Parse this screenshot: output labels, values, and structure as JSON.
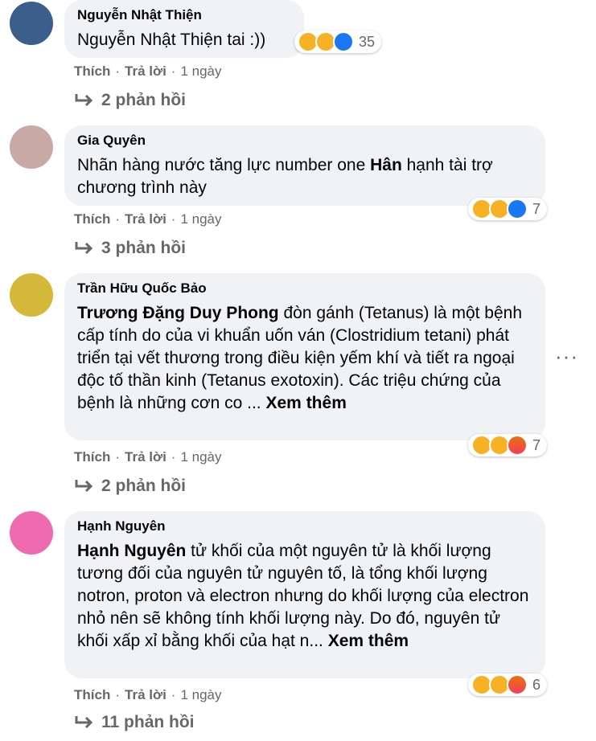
{
  "comments": [
    {
      "author": "Nguyễn Nhật Thiện",
      "text_plain": "Nguyễn Nhật Thiện tai :))",
      "action_like": "Thích",
      "action_reply": "Trả lời",
      "time": "1 ngày",
      "reaction_count": "35",
      "replies": "2 phản hồi",
      "avatar_color": "#3b5f8a"
    },
    {
      "author": "Gia Quyên",
      "text_pre": "Nhãn hàng nước tăng lực number one ",
      "text_bold": "Hân",
      "text_post": " hạnh tài trợ chương trình này",
      "action_like": "Thích",
      "action_reply": "Trả lời",
      "time": "1 ngày",
      "reaction_count": "7",
      "replies": "3 phản hồi",
      "avatar_color": "#c9a9a6"
    },
    {
      "author": "Trần Hữu Quốc Bảo",
      "text_bold": "Trương Đặng Duy Phong",
      "text_post": " đòn gánh (Tetanus) là một bệnh cấp tính do của vi khuẩn uốn ván (Clostridium tetani) phát triển tại vết thương trong điều kiện yếm khí và tiết ra ngoại độc tố thần kinh (Tetanus exotoxin). Các triệu chứng của bệnh là những cơn co ...",
      "see_more": "Xem thêm",
      "action_like": "Thích",
      "action_reply": "Trả lời",
      "time": "1 ngày",
      "reaction_count": "7",
      "replies": "2 phản hồi",
      "avatar_color": "#d4b83a"
    },
    {
      "author": "Hạnh Nguyên",
      "text_bold": "Hạnh Nguyên",
      "text_post": " tử khối của một nguyên tử là khối lượng tương đối của nguyên tử nguyên tố, là tổng khối lượng notron, proton và electron nhưng do khối lượng của electron nhỏ nên sẽ không tính khối lượng này. Do đó, nguyên tử khối xấp xỉ bằng khối của hạt n...",
      "see_more": "Xem thêm",
      "action_like": "Thích",
      "action_reply": "Trả lời",
      "time": "1 ngày",
      "reaction_count": "6",
      "replies": "11 phản hồi",
      "avatar_color": "#f06ab0"
    }
  ],
  "more_icon": "ellipsis-icon"
}
